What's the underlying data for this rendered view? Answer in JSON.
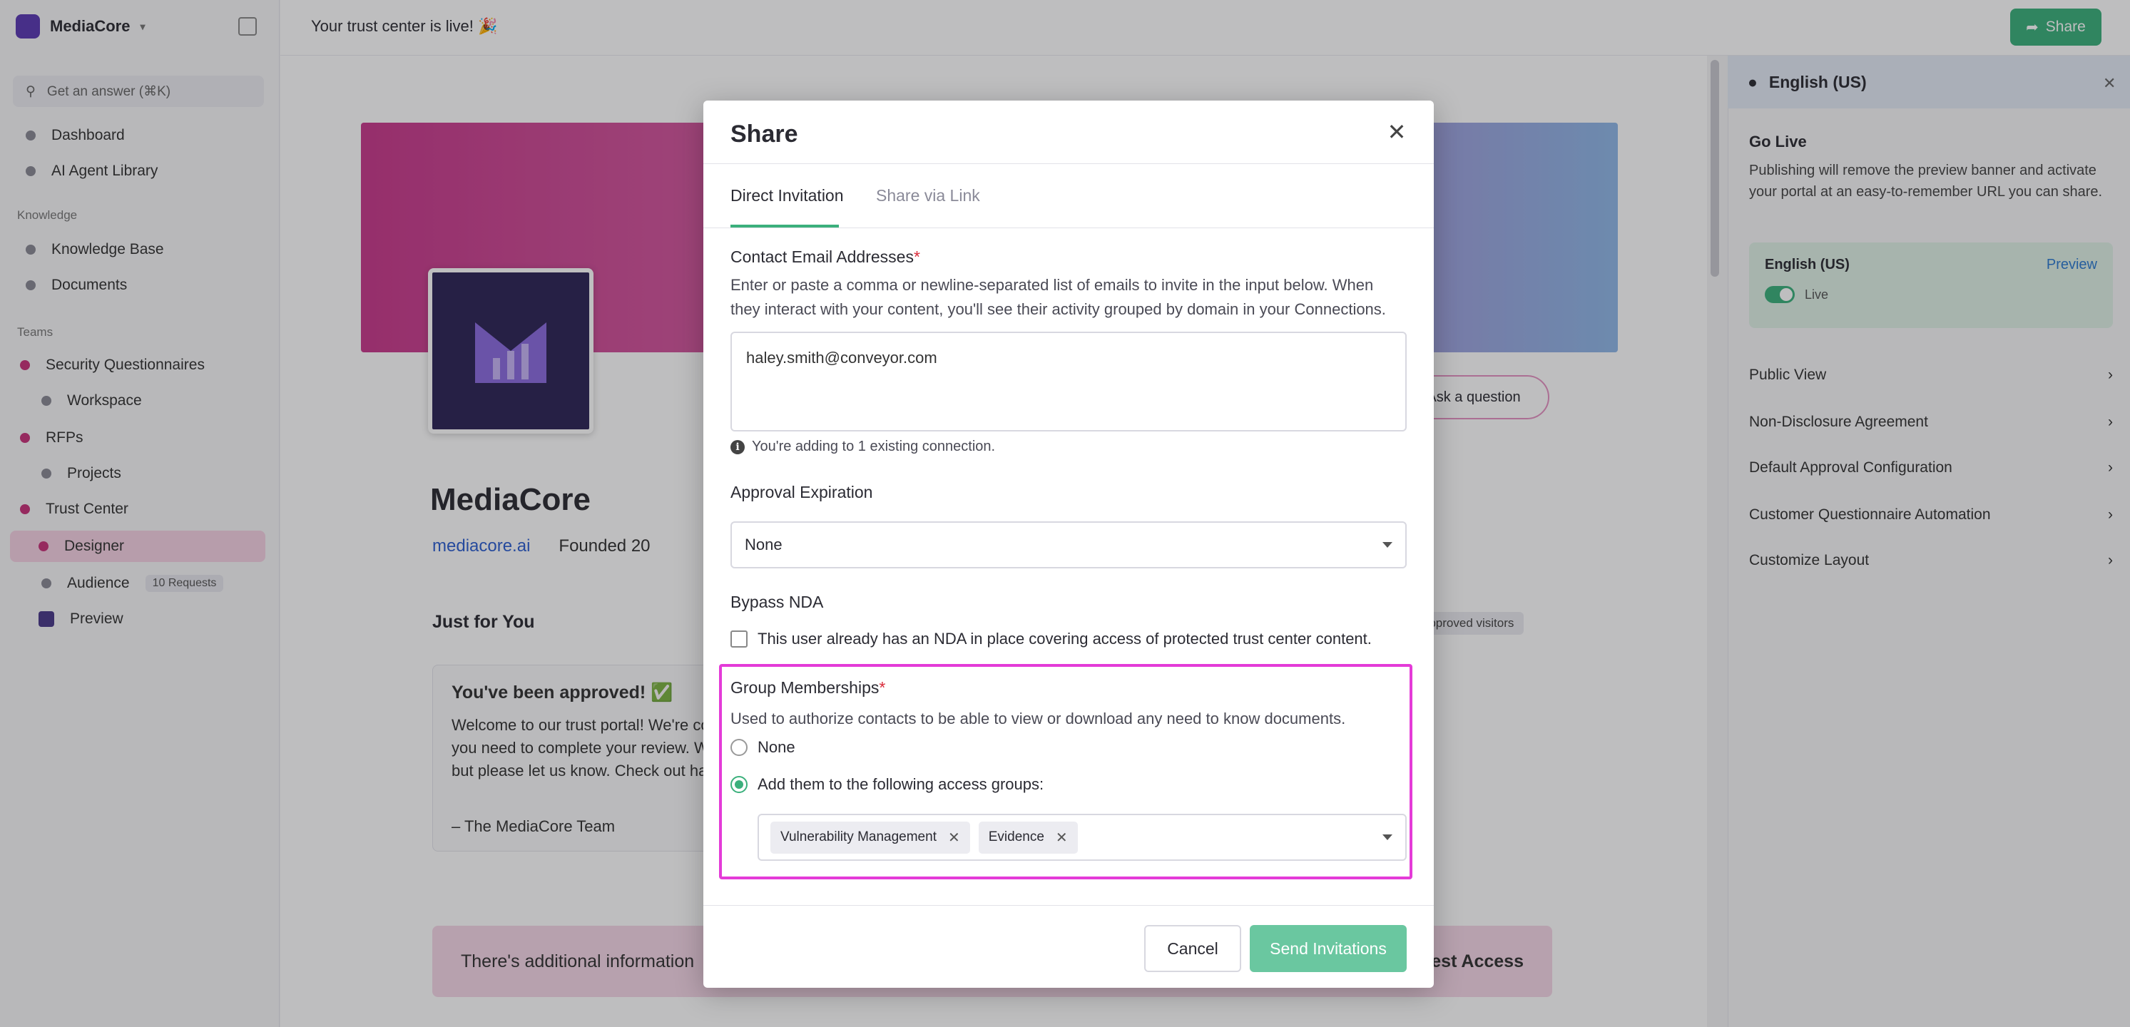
{
  "app": {
    "name": "MediaCore",
    "topbar_text": "Your trust center is live! 🎉",
    "share_label": "Share"
  },
  "sidebar": {
    "search_placeholder": "Get an answer (⌘K)",
    "items": [
      {
        "label": "Dashboard"
      },
      {
        "label": "AI Agent Library"
      }
    ],
    "knowledge_title": "Knowledge",
    "knowledge_items": [
      {
        "label": "Knowledge Base"
      },
      {
        "label": "Documents"
      }
    ],
    "teams_title": "Teams",
    "team_items": [
      {
        "label": "Security Questionnaires"
      },
      {
        "label": "Workspace"
      },
      {
        "label": "RFPs"
      },
      {
        "label": "Projects"
      },
      {
        "label": "Trust Center"
      },
      {
        "label": "Designer"
      },
      {
        "label": "Audience"
      },
      {
        "label": "Preview"
      }
    ],
    "audience_badge": "10 Requests"
  },
  "trust_center": {
    "company_name": "MediaCore",
    "website": "mediacore.ai",
    "founded": "Founded 20",
    "ask_button": "Ask a question",
    "just_for_you": "Just for You",
    "approved_pill": "Approved visitors",
    "approved_title": "You've been approved! ✅",
    "approved_body": "Welcome to our trust portal! We're committed to providing everything you need to complete your review. We have a lot of resources here, but please let us know. Check out happy-trail.com",
    "approved_sign": "– The MediaCore Team",
    "info_strip": "There's additional information",
    "info_strip_action": "Request Access"
  },
  "right_panel": {
    "language": "English (US)",
    "section_title": "Go Live",
    "section_text": "Publishing will remove the preview banner and activate your portal at an easy-to-remember URL you can share.",
    "card_title": "English (US)",
    "card_preview": "Preview",
    "card_status": "Live",
    "links": [
      "Public View",
      "Non-Disclosure Agreement",
      "Default Approval Configuration",
      "Customer Questionnaire Automation",
      "Customize Layout"
    ]
  },
  "modal": {
    "title": "Share",
    "tabs": [
      {
        "label": "Direct Invitation",
        "active": true
      },
      {
        "label": "Share via Link",
        "active": false
      }
    ],
    "emails_label": "Contact Email Addresses",
    "required_mark": "*",
    "emails_help": "Enter or paste a comma or newline-separated list of emails to invite in the input below. When they interact with your content, you'll see their activity grouped by domain in your Connections.",
    "emails_value": "haley.smith@conveyor.com",
    "emails_hint": "You're adding to 1 existing connection.",
    "expiration_label": "Approval Expiration",
    "expiration_value": "None",
    "nda_label": "Bypass NDA",
    "nda_checkbox": "This user already has an NDA in place covering access of protected trust center content.",
    "groups_label": "Group Memberships",
    "groups_help": "Used to authorize contacts to be able to view or download any need to know documents.",
    "groups_option_none": "None",
    "groups_option_add": "Add them to the following access groups:",
    "groups_selected": [
      "Vulnerability Management",
      "Evidence"
    ],
    "cancel_label": "Cancel",
    "send_label": "Send Invitations",
    "highlight_color": "#e43bd8",
    "accent_color": "#3bb07c"
  }
}
